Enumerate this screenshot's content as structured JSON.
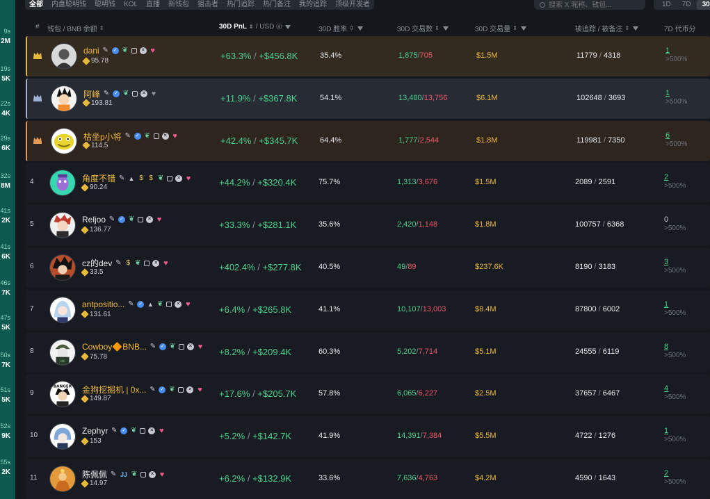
{
  "left_strip": [
    {
      "time": "9s",
      "val": "2M"
    },
    {
      "time": "19s",
      "val": "5K"
    },
    {
      "time": "22s",
      "val": "4K"
    },
    {
      "time": "29s",
      "val": "6K"
    },
    {
      "time": "32s",
      "val": "8M"
    },
    {
      "time": "41s",
      "val": "2K"
    },
    {
      "time": "41s",
      "val": "6K"
    },
    {
      "time": "46s",
      "val": "7K"
    },
    {
      "time": "47s",
      "val": "5K"
    },
    {
      "time": "50s",
      "val": "7K"
    },
    {
      "time": "51s",
      "val": "5K"
    },
    {
      "time": "52s",
      "val": "9K"
    },
    {
      "time": "55s",
      "val": "2K"
    }
  ],
  "tabs": [
    "全部",
    "内盘聪明钱",
    "聪明钱",
    "KOL",
    "直播",
    "新钱包",
    "狙击者",
    "热门追踪",
    "热门备注",
    "我的追踪",
    "顶级开发者"
  ],
  "search": {
    "placeholder": "搜索 X 昵称、钱包..."
  },
  "periods": [
    "1D",
    "7D",
    "30D"
  ],
  "headers": {
    "rank": "#",
    "wallet": "钱包 / BNB 余额",
    "pnl": "30D PnL",
    "pnl_unit": "/ USD",
    "winrate": "30D 胜率",
    "txs": "30D 交易数",
    "volume": "30D 交易量",
    "tracked": "被追踪 / 被备注",
    "tokens": "7D 代币分"
  },
  "rows": [
    {
      "rank": "1",
      "name": "dani",
      "icons": "std",
      "heart": "pink",
      "balance": "95.78",
      "pnl_pct": "+63.3%",
      "pnl_usd": "+$456.8K",
      "winrate": "35.4%",
      "buys": "1,875",
      "sells": "705",
      "volume": "$1.5M",
      "tracked": "11779",
      "noted": "4318",
      "tok_n": "1",
      "tok_s": ">500%"
    },
    {
      "rank": "2",
      "name": "阿峰",
      "icons": "std",
      "heart": "grey",
      "balance": "193.81",
      "pnl_pct": "+11.9%",
      "pnl_usd": "+$367.8K",
      "winrate": "54.1%",
      "buys": "13,480",
      "sells": "13,756",
      "volume": "$6.1M",
      "tracked": "102648",
      "noted": "3693",
      "tok_n": "1",
      "tok_s": ">500%"
    },
    {
      "rank": "3",
      "name": "枯坐p小将",
      "icons": "std",
      "heart": "pink",
      "balance": "114.5",
      "pnl_pct": "+42.4%",
      "pnl_usd": "+$345.7K",
      "winrate": "64.4%",
      "buys": "1,777",
      "sells": "2,544",
      "volume": "$1.8M",
      "tracked": "119981",
      "noted": "7350",
      "tok_n": "6",
      "tok_s": ">500%"
    },
    {
      "rank": "4",
      "name": "角度不错",
      "icons": "extra",
      "heart": "pink",
      "balance": "90.24",
      "pnl_pct": "+44.2%",
      "pnl_usd": "+$320.4K",
      "winrate": "75.7%",
      "buys": "1,313",
      "sells": "3,676",
      "volume": "$1.5M",
      "tracked": "2089",
      "noted": "2591",
      "tok_n": "2",
      "tok_s": ">500%"
    },
    {
      "rank": "5",
      "name": "Reljoo",
      "icons": "std",
      "heart": "pink",
      "balance": "136.77",
      "pnl_pct": "+33.3%",
      "pnl_usd": "+$281.1K",
      "winrate": "35.6%",
      "buys": "2,420",
      "sells": "1,148",
      "volume": "$1.8M",
      "tracked": "100757",
      "noted": "6368",
      "tok_n": "0",
      "tok_s": ">500%"
    },
    {
      "rank": "6",
      "name": "cz的dev",
      "icons": "bag",
      "heart": "pink",
      "balance": "33.5",
      "pnl_pct": "+402.4%",
      "pnl_usd": "+$277.8K",
      "winrate": "40.5%",
      "buys": "49",
      "sells": "89",
      "volume": "$237.6K",
      "tracked": "8190",
      "noted": "3183",
      "tok_n": "3",
      "tok_s": ">500%"
    },
    {
      "rank": "7",
      "name": "antpositio...",
      "icons": "person",
      "heart": "pink",
      "balance": "131.61",
      "pnl_pct": "+6.4%",
      "pnl_usd": "+$265.8K",
      "winrate": "41.1%",
      "buys": "10,107",
      "sells": "13,003",
      "volume": "$8.4M",
      "tracked": "87800",
      "noted": "6002",
      "tok_n": "1",
      "tok_s": ">500%"
    },
    {
      "rank": "8",
      "name": "Cowboy🔶BNB...",
      "icons": "std",
      "heart": "pink",
      "balance": "75.78",
      "pnl_pct": "+8.2%",
      "pnl_usd": "+$209.4K",
      "winrate": "60.3%",
      "buys": "5,202",
      "sells": "7,714",
      "volume": "$5.1M",
      "tracked": "24555",
      "noted": "6119",
      "tok_n": "8",
      "tok_s": ">500%"
    },
    {
      "rank": "9",
      "name": "金狗挖掘机 | 0x...",
      "icons": "std",
      "heart": "pink",
      "balance": "149.87",
      "pnl_pct": "+17.6%",
      "pnl_usd": "+$205.7K",
      "winrate": "57.8%",
      "buys": "6,065",
      "sells": "6,227",
      "volume": "$2.5M",
      "tracked": "37657",
      "noted": "6467",
      "tok_n": "4",
      "tok_s": ">500%"
    },
    {
      "rank": "10",
      "name": "Zephyr",
      "icons": "std",
      "heart": "pink",
      "balance": "153",
      "pnl_pct": "+5.2%",
      "pnl_usd": "+$142.7K",
      "winrate": "41.9%",
      "buys": "14,391",
      "sells": "7,384",
      "volume": "$5.5M",
      "tracked": "4722",
      "noted": "1276",
      "tok_n": "1",
      "tok_s": ">500%"
    },
    {
      "rank": "11",
      "name": "陈佩佩",
      "icons": "jj",
      "heart": "pink",
      "balance": "14.97",
      "pnl_pct": "+6.2%",
      "pnl_usd": "+$132.9K",
      "winrate": "33.6%",
      "buys": "7,636",
      "sells": "4,763",
      "volume": "$4.2M",
      "tracked": "4590",
      "noted": "1643",
      "tok_n": "2",
      "tok_s": ">500%"
    }
  ],
  "colors": {
    "positive": "#4bd18d",
    "negative": "#f0566a",
    "gold": "#f0b83c",
    "heart": "#f05a8a",
    "row1_bg": "#332a20",
    "row2_bg": "#272b34",
    "row3_bg": "#2e251f"
  }
}
